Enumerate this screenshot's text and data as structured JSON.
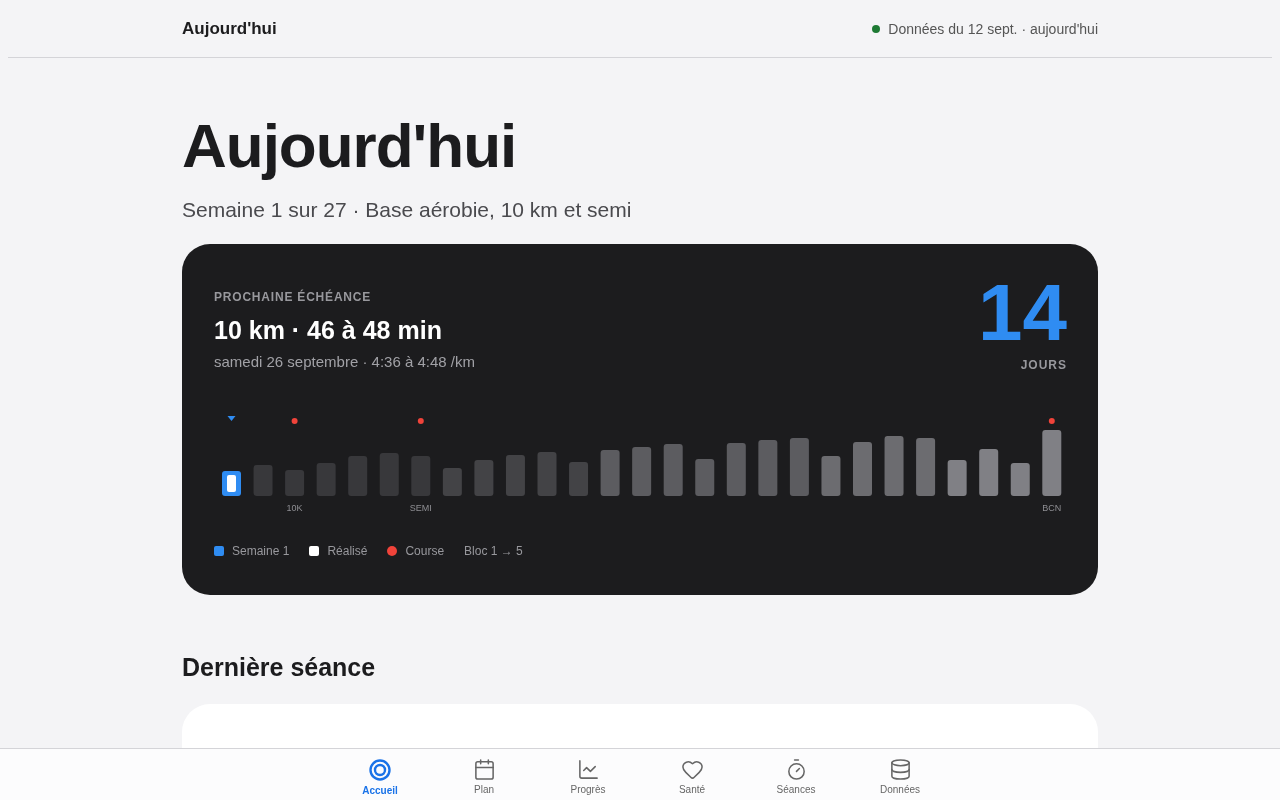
{
  "header": {
    "title": "Aujourd'hui",
    "status": {
      "text": "Données du 12 sept. · aujourd'hui",
      "color": "#1e7a34"
    }
  },
  "page": {
    "title": "Aujourd'hui",
    "subtitle": "Semaine 1 sur 27 · Base aérobie, 10 km et semi"
  },
  "deadline": {
    "eyebrow": "PROCHAINE ÉCHÉANCE",
    "title": "10 km · 46 à 48 min",
    "detail": "samedi 26 septembre · 4:36 à 4:48 /km",
    "count": "14",
    "unit": "JOURS",
    "weeks": [
      {
        "current": true,
        "race": false
      },
      {
        "current": false,
        "race": false
      },
      {
        "current": false,
        "race": true,
        "label": "10K"
      },
      {
        "current": false,
        "race": false
      },
      {
        "current": false,
        "race": false
      },
      {
        "current": false,
        "race": false
      },
      {
        "current": false,
        "race": true,
        "label": "SEMI"
      },
      {
        "current": false,
        "race": false
      },
      {
        "current": false,
        "race": false
      },
      {
        "current": false,
        "race": false
      },
      {
        "current": false,
        "race": false
      },
      {
        "current": false,
        "race": false
      },
      {
        "current": false,
        "race": false
      },
      {
        "current": false,
        "race": false
      },
      {
        "current": false,
        "race": false
      },
      {
        "current": false,
        "race": false
      },
      {
        "current": false,
        "race": false
      },
      {
        "current": false,
        "race": false
      },
      {
        "current": false,
        "race": false
      },
      {
        "current": false,
        "race": false
      },
      {
        "current": false,
        "race": false
      },
      {
        "current": false,
        "race": false
      },
      {
        "current": false,
        "race": false
      },
      {
        "current": false,
        "race": false
      },
      {
        "current": false,
        "race": false
      },
      {
        "current": false,
        "race": false
      },
      {
        "current": false,
        "race": true,
        "label": "BCN"
      }
    ],
    "legend": [
      {
        "label": "Semaine 1",
        "color": "#2f8cf2"
      },
      {
        "label": "Réalisé",
        "color": "#ffffff"
      },
      {
        "label": "Course",
        "color": "#f0433a"
      },
      {
        "label": "Bloc 1 → 5"
      }
    ]
  },
  "last_session": {
    "heading": "Dernière séance"
  },
  "nav": [
    {
      "label": "Accueil",
      "kind": "home",
      "selected": true
    },
    {
      "label": "Plan",
      "kind": "calendar",
      "selected": false
    },
    {
      "label": "Progrès",
      "kind": "chart",
      "selected": false
    },
    {
      "label": "Santé",
      "kind": "heart",
      "selected": false
    },
    {
      "label": "Séances",
      "kind": "timer",
      "selected": false
    },
    {
      "label": "Données",
      "kind": "database",
      "selected": false
    }
  ]
}
